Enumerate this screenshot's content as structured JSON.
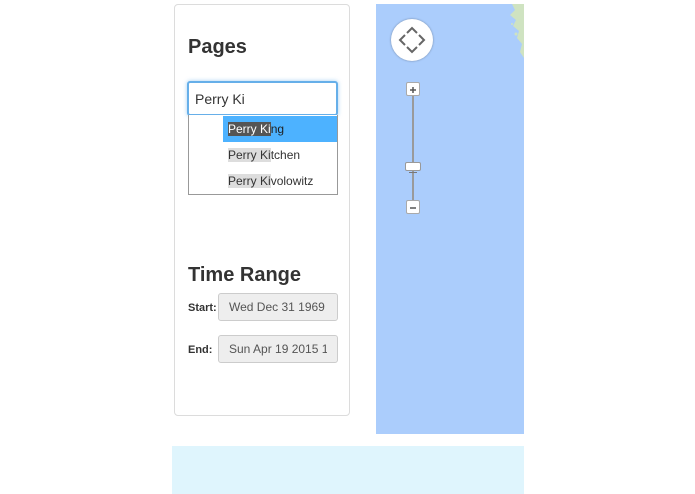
{
  "pages": {
    "title": "Pages",
    "search_value": "Perry Ki",
    "suggestions": [
      {
        "match": "Perry Ki",
        "rest": "ng"
      },
      {
        "match": "Perry Ki",
        "rest": "tchen"
      },
      {
        "match": "Perry Ki",
        "rest": "volowitz"
      }
    ]
  },
  "time_range": {
    "title": "Time Range",
    "start_label": "Start:",
    "start_value": "Wed Dec 31 1969",
    "end_label": "End:",
    "end_value": "Sun Apr 19 2015 1"
  },
  "map": {
    "water_color": "#abcdfc",
    "land_color": "#cfe3c1",
    "icons": [
      "pan-icon",
      "zoom-in-icon",
      "zoom-out-icon"
    ]
  },
  "colors": {
    "accent": "#66afe9",
    "selected": "#4db2ff",
    "footer": "#dff5fd"
  }
}
